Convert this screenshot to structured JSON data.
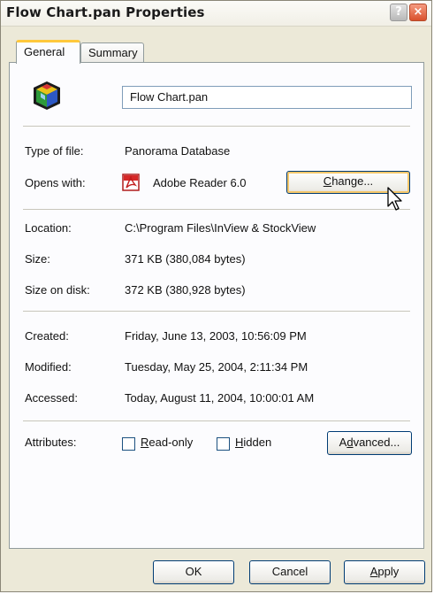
{
  "window": {
    "title": "Flow Chart.pan Properties",
    "help_glyph": "?",
    "close_glyph": "×"
  },
  "tabs": [
    {
      "label": "General",
      "selected": true
    },
    {
      "label": "Summary",
      "selected": false
    }
  ],
  "general": {
    "file_name": "Flow Chart.pan",
    "type_label": "Type of file:",
    "type_value": "Panorama Database",
    "opens_label": "Opens with:",
    "opens_value": "Adobe Reader 6.0",
    "change_button": {
      "pre": "",
      "accel": "C",
      "post": "hange..."
    },
    "location_label": "Location:",
    "location_value": "C:\\Program Files\\InView & StockView",
    "size_label": "Size:",
    "size_value": "371 KB (380,084 bytes)",
    "size_disk_label": "Size on disk:",
    "size_disk_value": "372 KB (380,928 bytes)",
    "created_label": "Created:",
    "created_value": "Friday, June 13, 2003, 10:56:09 PM",
    "modified_label": "Modified:",
    "modified_value": "Tuesday, May 25, 2004, 2:11:34 PM",
    "accessed_label": "Accessed:",
    "accessed_value": "Today, August 11, 2004, 10:00:01 AM",
    "attributes_label": "Attributes:",
    "readonly": {
      "accel": "R",
      "rest": "ead-only",
      "checked": false
    },
    "hidden": {
      "accel": "H",
      "rest": "idden",
      "checked": false
    },
    "advanced_button": {
      "pre": "A",
      "accel": "d",
      "post": "vanced..."
    }
  },
  "footer": {
    "ok_label": "OK",
    "cancel_label": "Cancel",
    "apply_button": {
      "accel": "A",
      "rest": "pply"
    }
  },
  "colors": {
    "accent_tab": "#ffc83c",
    "button_border": "#003c74",
    "close_button": "#d9512c"
  },
  "icons": [
    "file-type-icon",
    "adobe-reader-icon",
    "mouse-pointer-icon",
    "help-icon",
    "close-icon"
  ]
}
